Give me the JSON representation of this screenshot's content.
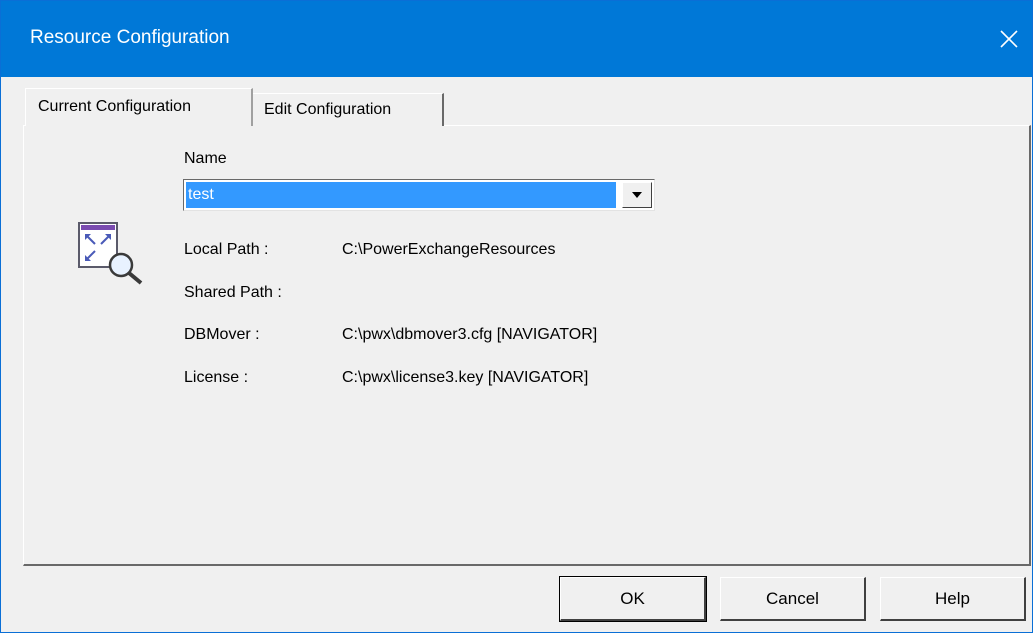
{
  "window": {
    "title": "Resource Configuration",
    "close_icon": "close-icon"
  },
  "tabs": [
    {
      "label": "Current Configuration",
      "active": true
    },
    {
      "label": "Edit Configuration",
      "active": false
    }
  ],
  "form": {
    "name_label": "Name",
    "name_value": "test",
    "resource_icon": "resource-search-icon",
    "fields": [
      {
        "label": "Local Path :",
        "value": "C:\\PowerExchangeResources"
      },
      {
        "label": "Shared Path :",
        "value": ""
      },
      {
        "label": "DBMover :",
        "value": "C:\\pwx\\dbmover3.cfg [NAVIGATOR]"
      },
      {
        "label": "License :",
        "value": "C:\\pwx\\license3.key [NAVIGATOR]"
      }
    ]
  },
  "buttons": {
    "ok": "OK",
    "cancel": "Cancel",
    "help": "Help"
  },
  "colors": {
    "titlebar": "#0078d7",
    "selection": "#3399ff",
    "face": "#f0f0f0"
  }
}
